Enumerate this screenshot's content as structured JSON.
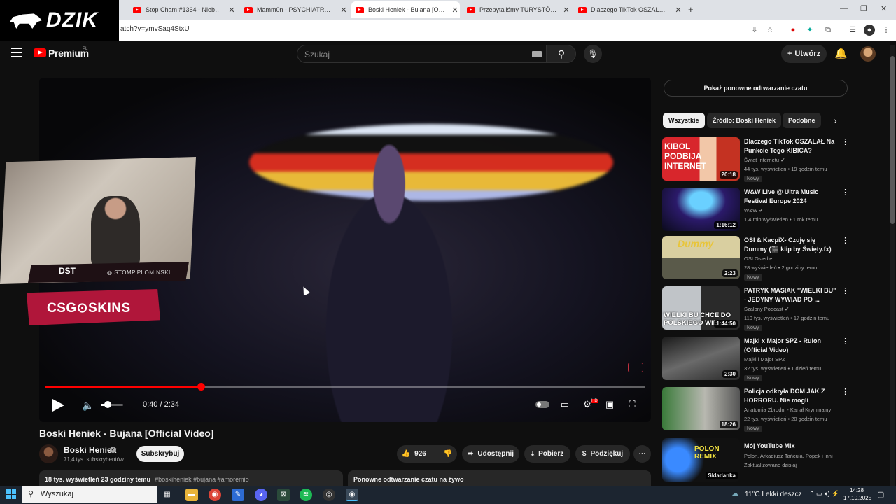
{
  "browser": {
    "tabs": [
      {
        "title": "Stop Cham #1364 - Niebezpiec"
      },
      {
        "title": "Mamm0n - PSYCHIATRYK [STRE"
      },
      {
        "title": "Boski Heniek - Bujana [Official V"
      },
      {
        "title": "Przepytaliśmy TURYSTÓW w Po"
      },
      {
        "title": "Dlaczego TikTok OSZALAŁ Na P"
      }
    ],
    "new_tab": "+",
    "url": "atch?v=ymvSaq4StxU"
  },
  "overlay": {
    "brand": "DZIK",
    "stomp_handle": "STOMP.PLOMINSKI",
    "camera_logo": "DST",
    "sponsor": "CSG⊙SKINS"
  },
  "youtube": {
    "logo_text": "Premium",
    "region": "PL",
    "search_placeholder": "Szukaj",
    "create_label": "Utwórz"
  },
  "player": {
    "time_display": "0:40 / 2:34",
    "progress": 0.26,
    "volume": 0.25
  },
  "video": {
    "title": "Boski Heniek - Bujana [Official Video]",
    "channel": "Boski Heniek",
    "subscribers": "71,4 tys. subskrybentów",
    "subscribe_label": "Subskrybuj",
    "likes": "926",
    "share_label": "Udostępnij",
    "download_label": "Pobierz",
    "thanks_label": "Podziękuj",
    "views_date": "18 tys. wyświetleń  23 godziny temu",
    "hashtags": "#boskiheniek #bujana #amoremio",
    "replay_box": "Ponowne odtwarzanie czatu na żywo"
  },
  "sidebar": {
    "chat_replay": "Pokaż ponowne odtwarzanie czatu",
    "chips": [
      "Wszystkie",
      "Źródło: Boski Heniek",
      "Podobne"
    ],
    "recommendations": [
      {
        "title": "Dlaczego TikTok OSZALAŁ Na Punkcie Tego KIBICA?",
        "channel": "Świat Internetu",
        "meta": "44 tys. wyświetleń • 19 godzin temu",
        "badge": "Nowy",
        "duration": "20:18",
        "thumb_text": "KIBOL PODBIJA INTERNET",
        "verified": true
      },
      {
        "title": "W&W Live @ Ultra Music Festival Europe 2024",
        "channel": "W&W",
        "meta": "1,4 mln wyświetleń • 1 rok temu",
        "badge": "",
        "duration": "1:16:12",
        "thumb_text": "",
        "verified": true
      },
      {
        "title": "OSI & KacpiX- Czuję się Dummy (🎬 klip by Święty.fx)",
        "channel": "OSI Osiedle",
        "meta": "28 wyświetleń • 2 godziny temu",
        "badge": "Nowy",
        "duration": "2:23",
        "thumb_text": "Dummy",
        "verified": false
      },
      {
        "title": "PATRYK MASIAK \"WIELKI BU\" - JEDYNY WYWIAD PO ...",
        "channel": "Szalony Podcast",
        "meta": "110 tys. wyświetleń • 17 godzin temu",
        "badge": "Nowy",
        "duration": "1:44:50",
        "thumb_text": "WIELKI BU CHCE DO POLSKIEGO WIE",
        "verified": true
      },
      {
        "title": "Majki x Major SPZ - Rulon (Official Video)",
        "channel": "Majki i Major SPZ",
        "meta": "32 tys. wyświetleń • 1 dzień temu",
        "badge": "Nowy",
        "duration": "2:30",
        "thumb_text": "",
        "verified": false
      },
      {
        "title": "Policja odkryła DOM JAK Z HORRORU. Nie mogli uwierzyć.",
        "channel": "Anatomia Zbrodni - Kanał Kryminalny",
        "meta": "22 tys. wyświetleń • 20 godzin temu",
        "badge": "Nowy",
        "duration": "18:26",
        "thumb_text": "",
        "verified": false
      },
      {
        "title": "Mój YouTube Mix",
        "channel": "Polon, Arkadiusz Tańcula, Popek i inni",
        "meta": "Zaktualizowano dzisiaj",
        "badge": "",
        "duration": "Składanka",
        "thumb_text": "POLON REMIX",
        "verified": false
      }
    ]
  },
  "taskbar": {
    "search": "Wyszukaj",
    "weather": "11°C  Lekki deszcz",
    "time": "14:28",
    "date": "17.10.2025"
  },
  "colors": {
    "accent": "#ff0000",
    "sponsor": "#b0163a"
  }
}
